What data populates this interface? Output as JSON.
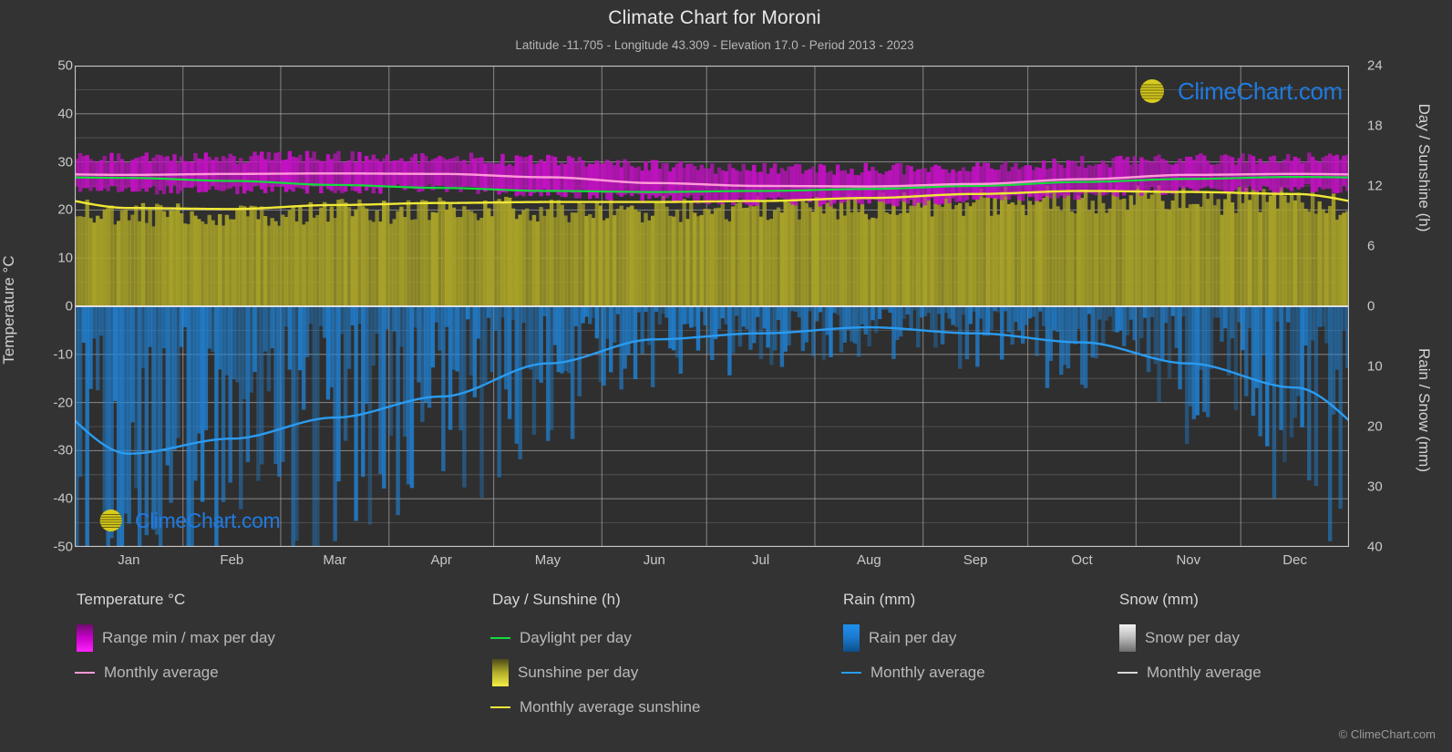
{
  "header": {
    "title": "Climate Chart for Moroni",
    "subtitle": "Latitude -11.705 - Longitude 43.309 - Elevation 17.0 - Period 2013 - 2023"
  },
  "branding": {
    "logo_text": "ClimeChart.com",
    "copyright": "© ClimeChart.com",
    "logo_ring_color": "#d11fd1",
    "logo_sphere_color": "#d6cb1f",
    "logo_text_color": "#1f7ae0"
  },
  "axes": {
    "left_title": "Temperature °C",
    "right_title_top": "Day / Sunshine (h)",
    "right_title_bottom": "Rain / Snow (mm)",
    "left_ticks": [
      50,
      40,
      30,
      20,
      10,
      0,
      -10,
      -20,
      -30,
      -40,
      -50
    ],
    "right_ticks_top": [
      24,
      18,
      12,
      6,
      0
    ],
    "right_ticks_bottom": [
      10,
      20,
      30,
      40
    ],
    "x_ticks": [
      "Jan",
      "Feb",
      "Mar",
      "Apr",
      "May",
      "Jun",
      "Jul",
      "Aug",
      "Sep",
      "Oct",
      "Nov",
      "Dec"
    ]
  },
  "legend": {
    "groups": [
      {
        "title": "Temperature °C",
        "items": [
          {
            "label": "Range min / max per day",
            "marker": "swatch",
            "style": "temp"
          },
          {
            "label": "Monthly average",
            "marker": "dash",
            "style": "temp-avg"
          }
        ]
      },
      {
        "title": "Day / Sunshine (h)",
        "items": [
          {
            "label": "Daylight per day",
            "marker": "dash",
            "style": "daylight"
          },
          {
            "label": "Sunshine per day",
            "marker": "swatch",
            "style": "sun"
          },
          {
            "label": "Monthly average sunshine",
            "marker": "dash",
            "style": "sun-avg"
          }
        ]
      },
      {
        "title": "Rain (mm)",
        "items": [
          {
            "label": "Rain per day",
            "marker": "swatch",
            "style": "rain"
          },
          {
            "label": "Monthly average",
            "marker": "dash",
            "style": "rain-avg"
          }
        ]
      },
      {
        "title": "Snow (mm)",
        "items": [
          {
            "label": "Snow per day",
            "marker": "swatch",
            "style": "snow"
          },
          {
            "label": "Monthly average",
            "marker": "dash",
            "style": "snow-avg"
          }
        ]
      }
    ]
  },
  "chart_data": {
    "type": "area",
    "title": "Climate Chart for Moroni",
    "subtitle": "Latitude -11.705 - Longitude 43.309 - Elevation 17.0 - Period 2013 - 2023",
    "xlabel": "",
    "ylabel": "Temperature °C",
    "ylim": [
      -50,
      50
    ],
    "y2lim_top_hours": [
      0,
      24
    ],
    "y2lim_bottom_mm": [
      0,
      40
    ],
    "grid": true,
    "legend_position": "below",
    "categories": [
      "Jan",
      "Feb",
      "Mar",
      "Apr",
      "May",
      "Jun",
      "Jul",
      "Aug",
      "Sep",
      "Oct",
      "Nov",
      "Dec"
    ],
    "series": [
      {
        "name": "Temperature monthly average (°C)",
        "color": "#ff9ad8",
        "units": "°C",
        "values": [
          27.3,
          27.5,
          27.6,
          27.5,
          26.8,
          25.6,
          25.0,
          24.9,
          25.4,
          26.4,
          27.3,
          27.5
        ]
      },
      {
        "name": "Temperature daily max (°C)",
        "color": "#ff22ff",
        "units": "°C",
        "values": [
          30.5,
          30.7,
          30.8,
          30.6,
          30.0,
          28.9,
          28.4,
          28.3,
          28.9,
          29.7,
          30.4,
          30.6
        ]
      },
      {
        "name": "Temperature daily min (°C)",
        "color": "#8a0f8a",
        "units": "°C",
        "values": [
          24.2,
          24.3,
          24.4,
          24.3,
          23.6,
          22.4,
          21.8,
          21.6,
          22.1,
          23.1,
          24.1,
          24.4
        ]
      },
      {
        "name": "Daylight per day (h)",
        "color": "#13dc3c",
        "units": "h",
        "values": [
          12.8,
          12.5,
          12.1,
          11.8,
          11.5,
          11.4,
          11.5,
          11.7,
          12.0,
          12.4,
          12.7,
          12.9
        ]
      },
      {
        "name": "Monthly average sunshine (h)",
        "color": "#f0e836",
        "units": "h",
        "values": [
          9.8,
          9.7,
          10.1,
          10.3,
          10.4,
          10.4,
          10.5,
          10.8,
          11.2,
          11.5,
          11.4,
          11.2
        ]
      },
      {
        "name": "Rain monthly average (mm)",
        "color": "#2a9bf0",
        "units": "mm",
        "values": [
          24.5,
          22.0,
          18.5,
          15.0,
          9.5,
          5.5,
          4.5,
          3.5,
          4.5,
          6.0,
          9.5,
          13.5
        ]
      },
      {
        "name": "Snow monthly average (mm)",
        "color": "#d8d8d8",
        "units": "mm",
        "values": [
          0,
          0,
          0,
          0,
          0,
          0,
          0,
          0,
          0,
          0,
          0,
          0
        ]
      }
    ]
  }
}
